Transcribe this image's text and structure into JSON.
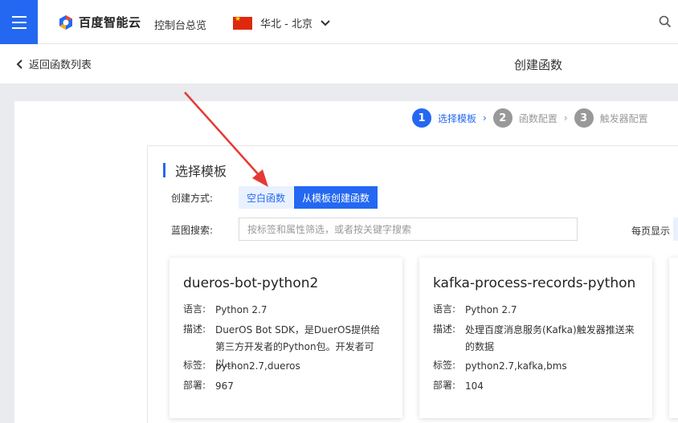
{
  "header": {
    "brand": "百度智能云",
    "overview": "控制台总览",
    "region": "华北 - 北京",
    "accent": "#2468f2"
  },
  "subbar": {
    "back": "返回函数列表",
    "title": "创建函数"
  },
  "steps": [
    {
      "num": "1",
      "label": "选择模板",
      "active": true
    },
    {
      "num": "2",
      "label": "函数配置",
      "active": false
    },
    {
      "num": "3",
      "label": "触发器配置",
      "active": false
    }
  ],
  "section": {
    "title": "选择模板",
    "create_label": "创建方式:",
    "tab_blank": "空白函数",
    "tab_template": "从模板创建函数",
    "search_label": "蓝图搜索:",
    "search_placeholder": "按标签和属性筛选，或者按关键字搜索",
    "perpage": "每页显示"
  },
  "cards": [
    {
      "title": "dueros-bot-python2",
      "lang_k": "语言:",
      "lang": "Python 2.7",
      "desc_k": "描述:",
      "desc": "DuerOS Bot SDK，是DuerOS提供给第三方开发者的Python包。开发者可以…",
      "tag_k": "标签:",
      "tags": "python2.7,dueros",
      "deploy_k": "部署:",
      "deploy": "967"
    },
    {
      "title": "kafka-process-records-python",
      "lang_k": "语言:",
      "lang": "Python 2.7",
      "desc_k": "描述:",
      "desc": "处理百度消息服务(Kafka)触发器推送来的数据",
      "tag_k": "标签:",
      "tags": "python2.7,kafka,bms",
      "deploy_k": "部署:",
      "deploy": "104"
    }
  ]
}
